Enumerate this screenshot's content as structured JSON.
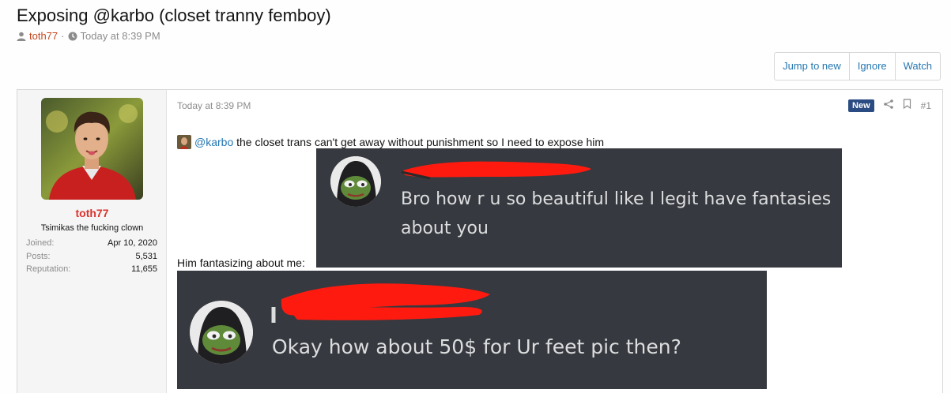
{
  "thread": {
    "title": "Exposing @karbo (closet tranny femboy)",
    "author": "toth77",
    "separator": "·",
    "date": "Today at 8:39 PM"
  },
  "toolbar": {
    "jump_label": "Jump to new",
    "ignore_label": "Ignore",
    "watch_label": "Watch"
  },
  "post": {
    "user": {
      "name": "toth77",
      "title": "Tsimikas the fucking clown",
      "stats": [
        {
          "label": "Joined:",
          "value": "Apr 10, 2020"
        },
        {
          "label": "Posts:",
          "value": "5,531"
        },
        {
          "label": "Reputation:",
          "value": "11,655"
        }
      ]
    },
    "date": "Today at 8:39 PM",
    "badge": "New",
    "number": "#1",
    "mention": "@karbo",
    "line1_rest": " the closet trans can't get away without punishment so I need to expose him",
    "line2": "Him fantasizing about me:",
    "screenshot1": {
      "message_line1": "Bro how r u so beautiful like I legit have fantasies",
      "message_line2": "about you"
    },
    "screenshot2": {
      "message": "Okay how about 50$ for Ur feet pic then?"
    }
  },
  "colors": {
    "accent_link": "#2577b1",
    "username_red": "#d9342e",
    "author_orange": "#c3451c",
    "badge_navy": "#2b4c82",
    "discord_bg": "#36393f",
    "redaction_red": "#ff0000"
  },
  "icons": {
    "author": "user-icon",
    "date": "clock-icon",
    "share": "share-icon",
    "bookmark": "bookmark-icon"
  }
}
